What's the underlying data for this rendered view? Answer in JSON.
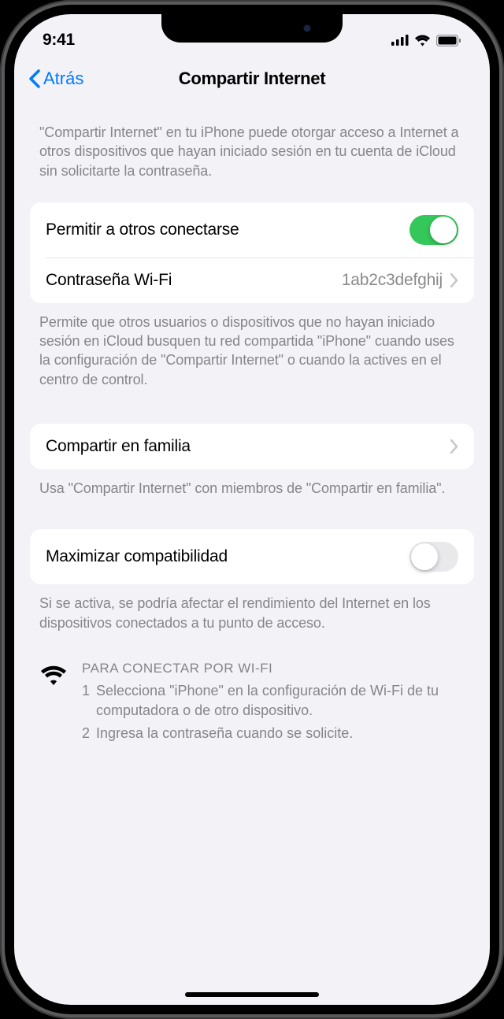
{
  "status": {
    "time": "9:41"
  },
  "nav": {
    "back_label": "Atrás",
    "title": "Compartir Internet"
  },
  "intro_text": "\"Compartir Internet\" en tu iPhone puede otorgar acceso a Internet a otros dispositivos que hayan iniciado sesión en tu cuenta de iCloud sin solicitarte la contraseña.",
  "allow_others": {
    "label": "Permitir a otros conectarse",
    "toggled_on": true
  },
  "wifi_password": {
    "label": "Contraseña Wi-Fi",
    "value": "1ab2c3defghij"
  },
  "allow_footer": "Permite que otros usuarios o dispositivos que no hayan iniciado sesión en iCloud busquen tu red compartida \"iPhone\" cuando uses la configuración de \"Compartir Internet\" o cuando la actives en el centro de control.",
  "family_sharing": {
    "label": "Compartir en familia",
    "footer": "Usa \"Compartir Internet\" con miembros de \"Compartir en familia\"."
  },
  "compatibility": {
    "label": "Maximizar compatibilidad",
    "toggled_on": false,
    "footer": "Si se activa, se podría afectar el rendimiento del Internet en los dispositivos conectados a tu punto de acceso."
  },
  "wifi_instructions": {
    "title": "PARA CONECTAR POR WI-FI",
    "step1_num": "1",
    "step1": "Selecciona \"iPhone\" en la configuración de Wi-Fi de tu computadora o de otro dispositivo.",
    "step2_num": "2",
    "step2": "Ingresa la contraseña cuando se solicite."
  }
}
